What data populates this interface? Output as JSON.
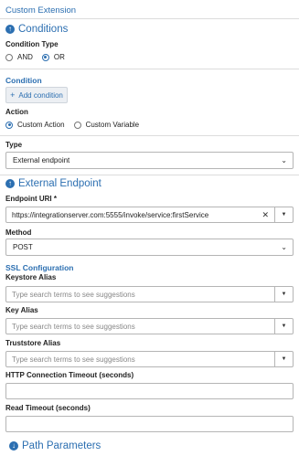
{
  "header": {
    "title": "Custom Extension"
  },
  "conditions_section": {
    "title": "Conditions",
    "icon": "arrow-up-circle-icon"
  },
  "condition_type": {
    "label": "Condition Type",
    "options": [
      "AND",
      "OR"
    ],
    "selected": "OR"
  },
  "condition": {
    "title": "Condition",
    "add_button": "Add condition",
    "add_icon": "plus-icon"
  },
  "action": {
    "label": "Action",
    "options": [
      "Custom Action",
      "Custom Variable"
    ],
    "selected": "Custom Action"
  },
  "type": {
    "label": "Type",
    "value": "External endpoint"
  },
  "external_endpoint_section": {
    "title": "External Endpoint",
    "icon": "arrow-up-circle-icon"
  },
  "endpoint_uri": {
    "label": "Endpoint URI *",
    "value": "https://integrationserver.com:5555/invoke/service:firstService"
  },
  "method": {
    "label": "Method",
    "value": "POST"
  },
  "ssl": {
    "title": "SSL Configuration",
    "keystore_alias": {
      "label": "Keystore Alias",
      "placeholder": "Type search terms to see suggestions"
    },
    "key_alias": {
      "label": "Key Alias",
      "placeholder": "Type search terms to see suggestions"
    },
    "truststore_alias": {
      "label": "Truststore Alias",
      "placeholder": "Type search terms to see suggestions"
    }
  },
  "http_timeout": {
    "label": "HTTP Connection Timeout (seconds)",
    "value": ""
  },
  "read_timeout": {
    "label": "Read Timeout (seconds)",
    "value": ""
  },
  "path_parameters_section": {
    "title": "Path Parameters",
    "icon": "arrow-down-circle-icon"
  },
  "colors": {
    "accent": "#2c6fb1",
    "border": "#b5b5b5",
    "divider": "#dcdcdc"
  }
}
